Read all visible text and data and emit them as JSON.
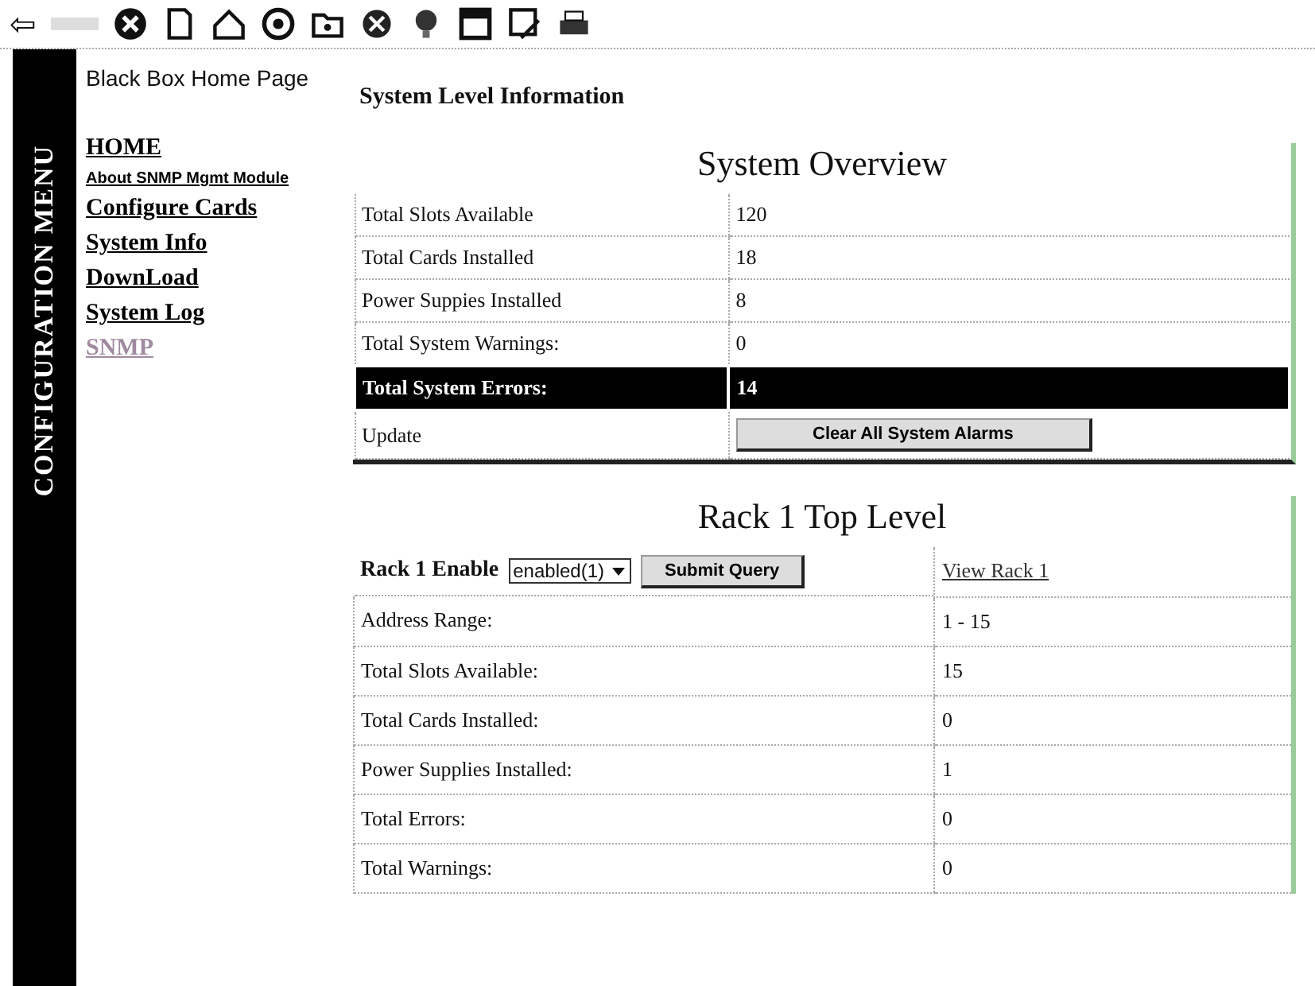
{
  "toolbar": {
    "back": "⇦"
  },
  "sidebar": {
    "title": "CONFIGURATION MENU",
    "home_link": "Black Box Home Page",
    "items": [
      {
        "label": "HOME",
        "kind": "large"
      },
      {
        "label": "About SNMP Mgmt Module",
        "kind": "small"
      },
      {
        "label": "Configure Cards",
        "kind": "large"
      },
      {
        "label": "System Info",
        "kind": "large"
      },
      {
        "label": "DownLoad",
        "kind": "large"
      },
      {
        "label": "System Log",
        "kind": "large"
      },
      {
        "label": "SNMP",
        "kind": "visited"
      }
    ]
  },
  "page_title": "System Level Information",
  "overview": {
    "title": "System Overview",
    "rows": [
      {
        "label": "Total Slots Available",
        "value": "120",
        "highlighted": false
      },
      {
        "label": "Total Cards Installed",
        "value": "18",
        "highlighted": false
      },
      {
        "label": "Power Suppies Installed",
        "value": "8",
        "highlighted": false
      },
      {
        "label": "Total System Warnings:",
        "value": "0",
        "highlighted": false
      },
      {
        "label": "Total System Errors:",
        "value": "14",
        "highlighted": true
      }
    ],
    "update_label": "Update",
    "clear_button": "Clear All System Alarms"
  },
  "rack": {
    "title": "Rack 1 Top Level",
    "enable_label": "Rack 1 Enable",
    "enable_value": "enabled(1)",
    "submit_button": "Submit Query",
    "view_link": "View Rack 1",
    "rows": [
      {
        "label": "Address Range:",
        "value": "1 - 15"
      },
      {
        "label": "Total Slots Available:",
        "value": "15"
      },
      {
        "label": "Total Cards Installed:",
        "value": "0"
      },
      {
        "label": "Power Supplies Installed:",
        "value": "1"
      },
      {
        "label": "Total Errors:",
        "value": "0"
      },
      {
        "label": "Total Warnings:",
        "value": "0"
      }
    ]
  }
}
